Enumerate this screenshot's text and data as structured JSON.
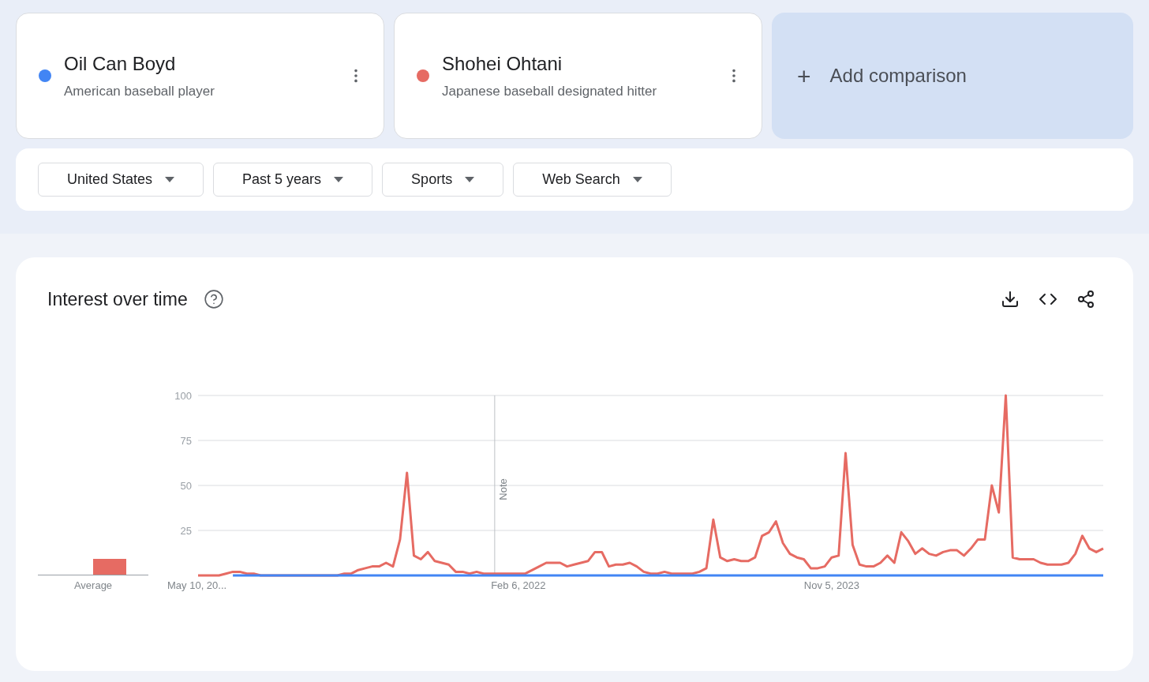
{
  "terms": [
    {
      "name": "Oil Can Boyd",
      "description": "American baseball player",
      "color": "#4285f4"
    },
    {
      "name": "Shohei Ohtani",
      "description": "Japanese baseball designated hitter",
      "color": "#e66b63"
    }
  ],
  "add_comparison": {
    "icon": "+",
    "label": "Add comparison"
  },
  "filters": [
    "United States",
    "Past 5 years",
    "Sports",
    "Web Search"
  ],
  "interest_over_time": {
    "title": "Interest over time",
    "average": {
      "label": "Average"
    },
    "chart_data": {
      "type": "line",
      "categories": [
        "May 10, 20...",
        null,
        null,
        null,
        null,
        null,
        null,
        null,
        null,
        null,
        null,
        null,
        null,
        null,
        null,
        null,
        null,
        null,
        null,
        null,
        null,
        null,
        null,
        null,
        null,
        null,
        null,
        null,
        null,
        null,
        null,
        null,
        null,
        null,
        null,
        null,
        null,
        null,
        null,
        null,
        null,
        null,
        null,
        null,
        null,
        null,
        "Feb 6, 2022",
        null,
        null,
        null,
        null,
        null,
        null,
        null,
        null,
        null,
        null,
        null,
        null,
        null,
        null,
        null,
        null,
        null,
        null,
        null,
        null,
        null,
        null,
        null,
        null,
        null,
        null,
        null,
        null,
        null,
        null,
        null,
        null,
        null,
        null,
        null,
        null,
        null,
        null,
        null,
        null,
        null,
        null,
        null,
        null,
        "Nov 5, 2023",
        null,
        null,
        null,
        null,
        null,
        null,
        null,
        null,
        null,
        null,
        null,
        null,
        null,
        null,
        null,
        null,
        null,
        null,
        null,
        null,
        null,
        null,
        null,
        null,
        null,
        null,
        null,
        null,
        null,
        null,
        null,
        null,
        null,
        null,
        null,
        null,
        null,
        null,
        null
      ],
      "ylim": [
        0,
        100
      ],
      "yticks": [
        25,
        50,
        75,
        100
      ],
      "grid": true,
      "annotations": [
        {
          "text": "Note"
        }
      ],
      "series": [
        {
          "color": "#4285f4",
          "values": [
            null,
            null,
            null,
            null,
            null,
            0,
            0,
            0,
            0,
            0,
            0,
            0,
            0,
            0,
            0,
            0,
            0,
            0,
            0,
            0,
            0,
            0,
            0,
            0,
            0,
            0,
            0,
            0,
            0,
            0,
            0,
            0,
            0,
            0,
            0,
            0,
            0,
            0,
            0,
            0,
            0,
            0,
            0,
            0,
            0,
            0,
            0,
            0,
            0,
            0,
            0,
            0,
            0,
            0,
            0,
            0,
            0,
            0,
            0,
            0,
            0,
            0,
            0,
            0,
            0,
            0,
            0,
            0,
            0,
            0,
            0,
            0,
            0,
            0,
            0,
            0,
            0,
            0,
            0,
            0,
            0,
            0,
            0,
            0,
            0,
            0,
            0,
            0,
            0,
            0,
            0,
            0,
            0,
            0,
            0,
            0,
            0,
            0,
            0,
            0,
            0,
            0,
            0,
            0,
            0,
            0,
            0,
            0,
            0,
            0,
            0,
            0,
            0,
            0,
            0,
            0,
            0,
            0,
            0,
            0,
            0,
            0,
            0,
            0,
            0,
            0,
            0,
            0,
            0,
            0,
            0
          ]
        },
        {
          "color": "#e66b63",
          "values": [
            0,
            0,
            0,
            0,
            1,
            2,
            2,
            1,
            1,
            0,
            0,
            0,
            0,
            0,
            0,
            0,
            0,
            0,
            0,
            0,
            0,
            1,
            1,
            3,
            4,
            5,
            5,
            7,
            5,
            20,
            57,
            11,
            9,
            13,
            8,
            7,
            6,
            2,
            2,
            1,
            2,
            1,
            1,
            1,
            1,
            1,
            1,
            1,
            3,
            5,
            7,
            7,
            7,
            5,
            6,
            7,
            8,
            13,
            13,
            5,
            6,
            6,
            7,
            5,
            2,
            1,
            1,
            2,
            1,
            1,
            1,
            1,
            2,
            4,
            31,
            10,
            8,
            9,
            8,
            8,
            10,
            22,
            24,
            30,
            18,
            12,
            10,
            9,
            4,
            4,
            5,
            10,
            11,
            68,
            17,
            6,
            5,
            5,
            7,
            11,
            7,
            24,
            19,
            12,
            15,
            12,
            11,
            13,
            14,
            14,
            11,
            15,
            20,
            20,
            50,
            35,
            100,
            10,
            9,
            9,
            9,
            7,
            6,
            6,
            6,
            7,
            12,
            22,
            15,
            13,
            15
          ]
        }
      ]
    }
  }
}
